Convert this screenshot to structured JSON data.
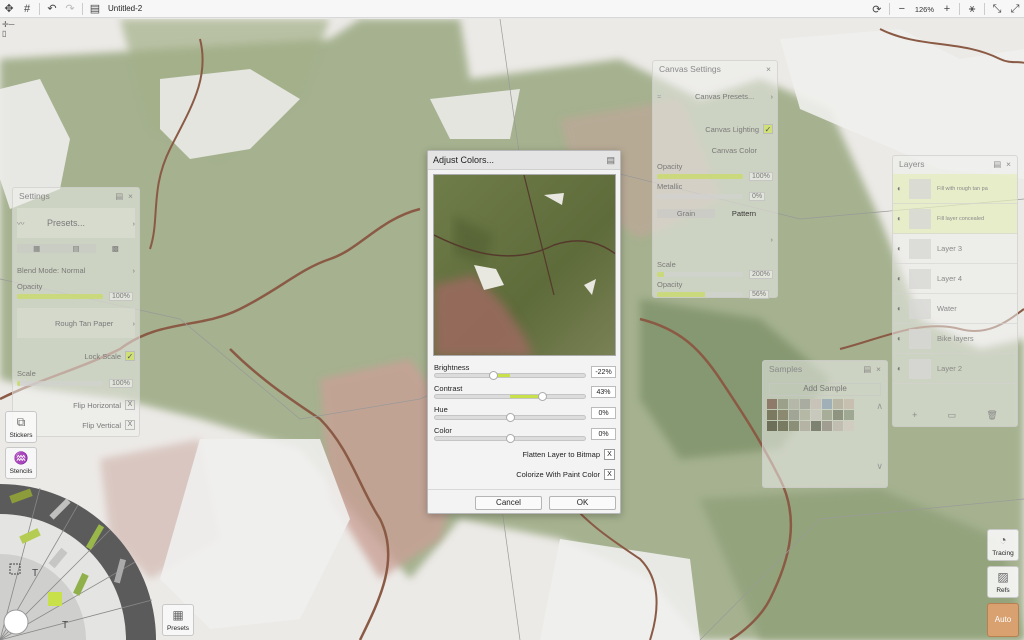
{
  "topbar": {
    "document_title": "Untitled-2",
    "zoom": "126%"
  },
  "settings_panel": {
    "title": "Settings",
    "presets_label": "Presets...",
    "blend_mode_label": "Blend Mode: Normal",
    "opacity_label": "Opacity",
    "opacity_value": "100%",
    "opacity_level": 100,
    "paper_label": "Rough Tan Paper",
    "lock_scale_label": "Lock Scale",
    "scale_label": "Scale",
    "scale_value": "100%",
    "scale_level": 20,
    "flip_horizontal_label": "Flip Horizontal",
    "flip_vertical_label": "Flip Vertical",
    "x_mark": "X"
  },
  "canvas_settings_panel": {
    "title": "Canvas Settings",
    "presets_label": "Canvas Presets...",
    "canvas_lighting_label": "Canvas Lighting",
    "canvas_color_label": "Canvas Color",
    "opacity_label": "Opacity",
    "opacity_value": "100%",
    "opacity_level": 100,
    "metallic_label": "Metallic",
    "metallic_value": "0%",
    "metallic_level": 0,
    "tab_grain": "Grain",
    "tab_pattern": "Pattern",
    "scale_label": "Scale",
    "scale_value": "200%",
    "scale_level": 40,
    "opacity2_label": "Opacity",
    "opacity2_value": "56%",
    "opacity2_level": 56
  },
  "layers_panel": {
    "title": "Layers",
    "layers": [
      {
        "name": "Fill with rough tan pa"
      },
      {
        "name": "Fill layer concealed"
      },
      {
        "name": "Layer 3"
      },
      {
        "name": "Layer 4"
      },
      {
        "name": "Water"
      },
      {
        "name": "Bike layers"
      },
      {
        "name": "Layer 2"
      }
    ]
  },
  "samples_panel": {
    "title": "Samples",
    "add_sample_label": "Add Sample",
    "colors": [
      "#8f7a6a",
      "#9aa08a",
      "#b5b8a8",
      "#a9aca0",
      "#c8c2b8",
      "#9fb0b8",
      "#b9b6a5",
      "#c7c0b0",
      "#7b7a60",
      "#8b8a70",
      "#a1a596",
      "#b6b8a6",
      "#c9c8bc",
      "#a7ad98",
      "#8e9480",
      "#9fa892",
      "#6d6f58",
      "#787a62",
      "#8c8f78",
      "#b4b3a4",
      "#7e8270",
      "#a19d90",
      "#c1bdb0",
      "#d0ccc0"
    ]
  },
  "adjust_colors_dialog": {
    "title": "Adjust Colors...",
    "brightness_label": "Brightness",
    "brightness_value": "-22%",
    "brightness_level": -22,
    "contrast_label": "Contrast",
    "contrast_value": "43%",
    "contrast_level": 43,
    "hue_label": "Hue",
    "hue_value": "0%",
    "hue_level": 0,
    "color_label": "Color",
    "color_value": "0%",
    "color_level": 0,
    "flatten_label": "Flatten Layer to Bitmap",
    "colorize_label": "Colorize With Paint Color",
    "x_mark": "X",
    "cancel_label": "Cancel",
    "ok_label": "OK"
  },
  "left_tools": {
    "stickers_label": "Stickers",
    "stencils_label": "Stencils",
    "presets_label": "Presets"
  },
  "right_tools": {
    "tracing_label": "Tracing",
    "refs_label": "Refs",
    "auto_label": "Auto"
  },
  "colors": {
    "accent": "#c8e04a",
    "map_green": "#8b9c6e",
    "map_red": "#b88a80",
    "river": "#8a5a45",
    "auto_button": "#d9a070"
  }
}
